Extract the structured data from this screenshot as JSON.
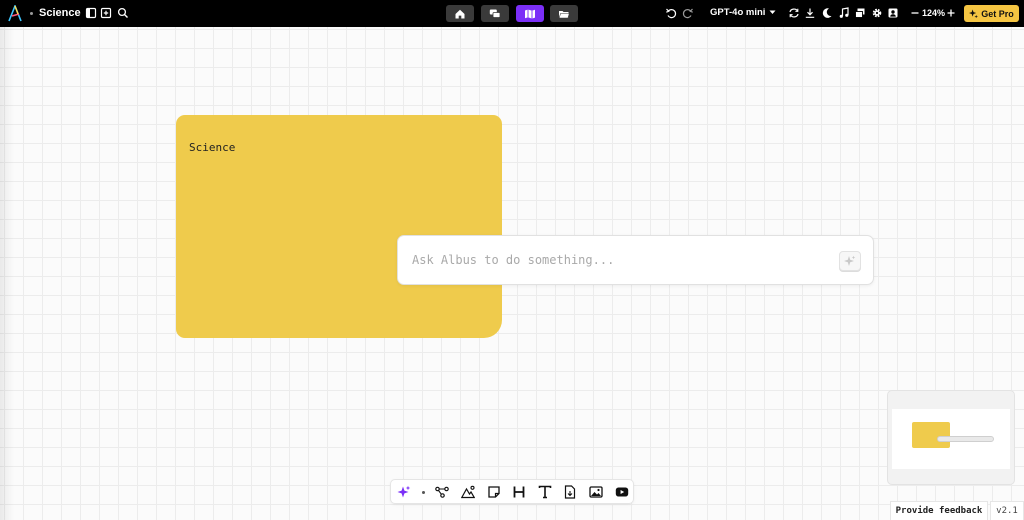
{
  "app": {
    "board_title": "Science",
    "logo": "albus-logo"
  },
  "header": {
    "left_icons": [
      "sidebar-panel-icon",
      "add-board-icon",
      "search-icon"
    ],
    "nav": [
      {
        "name": "home-icon",
        "active": false
      },
      {
        "name": "chat-icon",
        "active": false
      },
      {
        "name": "map-icon",
        "active": true
      },
      {
        "name": "folder-icon",
        "active": false
      }
    ],
    "model": "GPT-4o mini",
    "right_icons": [
      "undo-icon",
      "redo-icon",
      "sync-icon",
      "download-icon",
      "moon-icon",
      "music-icon",
      "layers-icon",
      "gear-icon",
      "account-icon"
    ],
    "zoom": "124%",
    "get_pro_label": "Get Pro",
    "accent": "#7b2ff7",
    "pro_color": "#f5c542"
  },
  "canvas": {
    "note": {
      "text": "Science",
      "color": "#efcb4c"
    },
    "ask": {
      "placeholder": "Ask Albus to do something...",
      "value": ""
    }
  },
  "toolbar": {
    "tools": [
      "ai-sparkle-icon",
      "mind-map-icon",
      "image-shape-icon",
      "sticky-note-icon",
      "heading-icon",
      "text-icon",
      "document-icon",
      "image-icon",
      "youtube-icon"
    ]
  },
  "footer": {
    "feedback_label": "Provide feedback",
    "version": "v2.1"
  }
}
